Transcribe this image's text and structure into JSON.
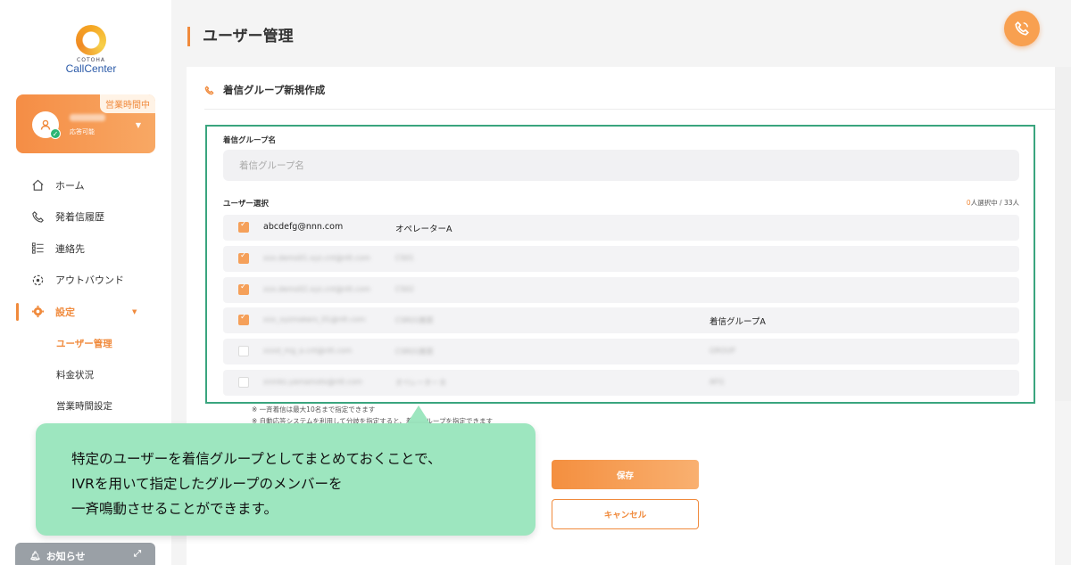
{
  "sidebar": {
    "logo": {
      "small": "COTOHA",
      "name": "CallCenter"
    },
    "status": {
      "badge": "営業時間中",
      "state": "応答可能"
    },
    "nav": [
      {
        "label": "ホーム",
        "icon": "home-icon"
      },
      {
        "label": "発着信履歴",
        "icon": "phone-history-icon"
      },
      {
        "label": "連絡先",
        "icon": "contacts-icon"
      },
      {
        "label": "アウトバウンド",
        "icon": "outbound-icon"
      },
      {
        "label": "設定",
        "icon": "gear-icon"
      }
    ],
    "subnav": [
      {
        "label": "ユーザー管理"
      },
      {
        "label": "料金状況"
      },
      {
        "label": "営業時間設定"
      }
    ],
    "notice": "お知らせ"
  },
  "page": {
    "title": "ユーザー管理"
  },
  "form": {
    "heading": "着信グループ新規作成",
    "name_label": "着信グループ名",
    "name_placeholder": "着信グループ名",
    "user_select_label": "ユーザー選択",
    "counter_num": "0",
    "counter_text": "人選択中 / 33人",
    "rows": [
      {
        "checked": true,
        "email": "abcdefg@nnn.com",
        "name": "オペレーターA",
        "group": "",
        "blurred": false
      },
      {
        "checked": true,
        "email": "xxx.demo01.xyz.cnt@ntt.com",
        "name": "CS01",
        "group": "",
        "blurred": true
      },
      {
        "checked": true,
        "email": "xxx.demo02.xyz.cnt@ntt.com",
        "name": "CS02",
        "group": "",
        "blurred": true
      },
      {
        "checked": true,
        "email": "xxx_xyzmakers_01@ntt.com",
        "name": "CSR01推奨",
        "group": "着信グループA",
        "blurred": true,
        "group_blurred": false
      },
      {
        "checked": false,
        "email": "xxxd_mg_a.cnt@ntt.com",
        "name": "CSR01推奨",
        "group": "GROUP",
        "blurred": true,
        "group_blurred": true
      },
      {
        "checked": false,
        "email": "xnmks.yamamoto@ntt.com",
        "name": "オペレーター B",
        "group": "AFG",
        "blurred": true,
        "group_blurred": true
      }
    ],
    "notes": [
      "※ 一斉着信は最大10名まで指定できます",
      "※ 自動応答システムを利用して分岐を指定すると、着信グループを指定できます"
    ],
    "save_label": "保存",
    "cancel_label": "キャンセル"
  },
  "callout": {
    "lines": [
      "特定のユーザーを着信グループとしてまとめておくことで、",
      "IVRを用いて指定したグループのメンバーを",
      "一斉鳴動させることができます。"
    ]
  },
  "colors": {
    "accent": "#f08a3c",
    "highlight_frame": "#3aa57e",
    "callout_bg": "#9de6bf"
  }
}
